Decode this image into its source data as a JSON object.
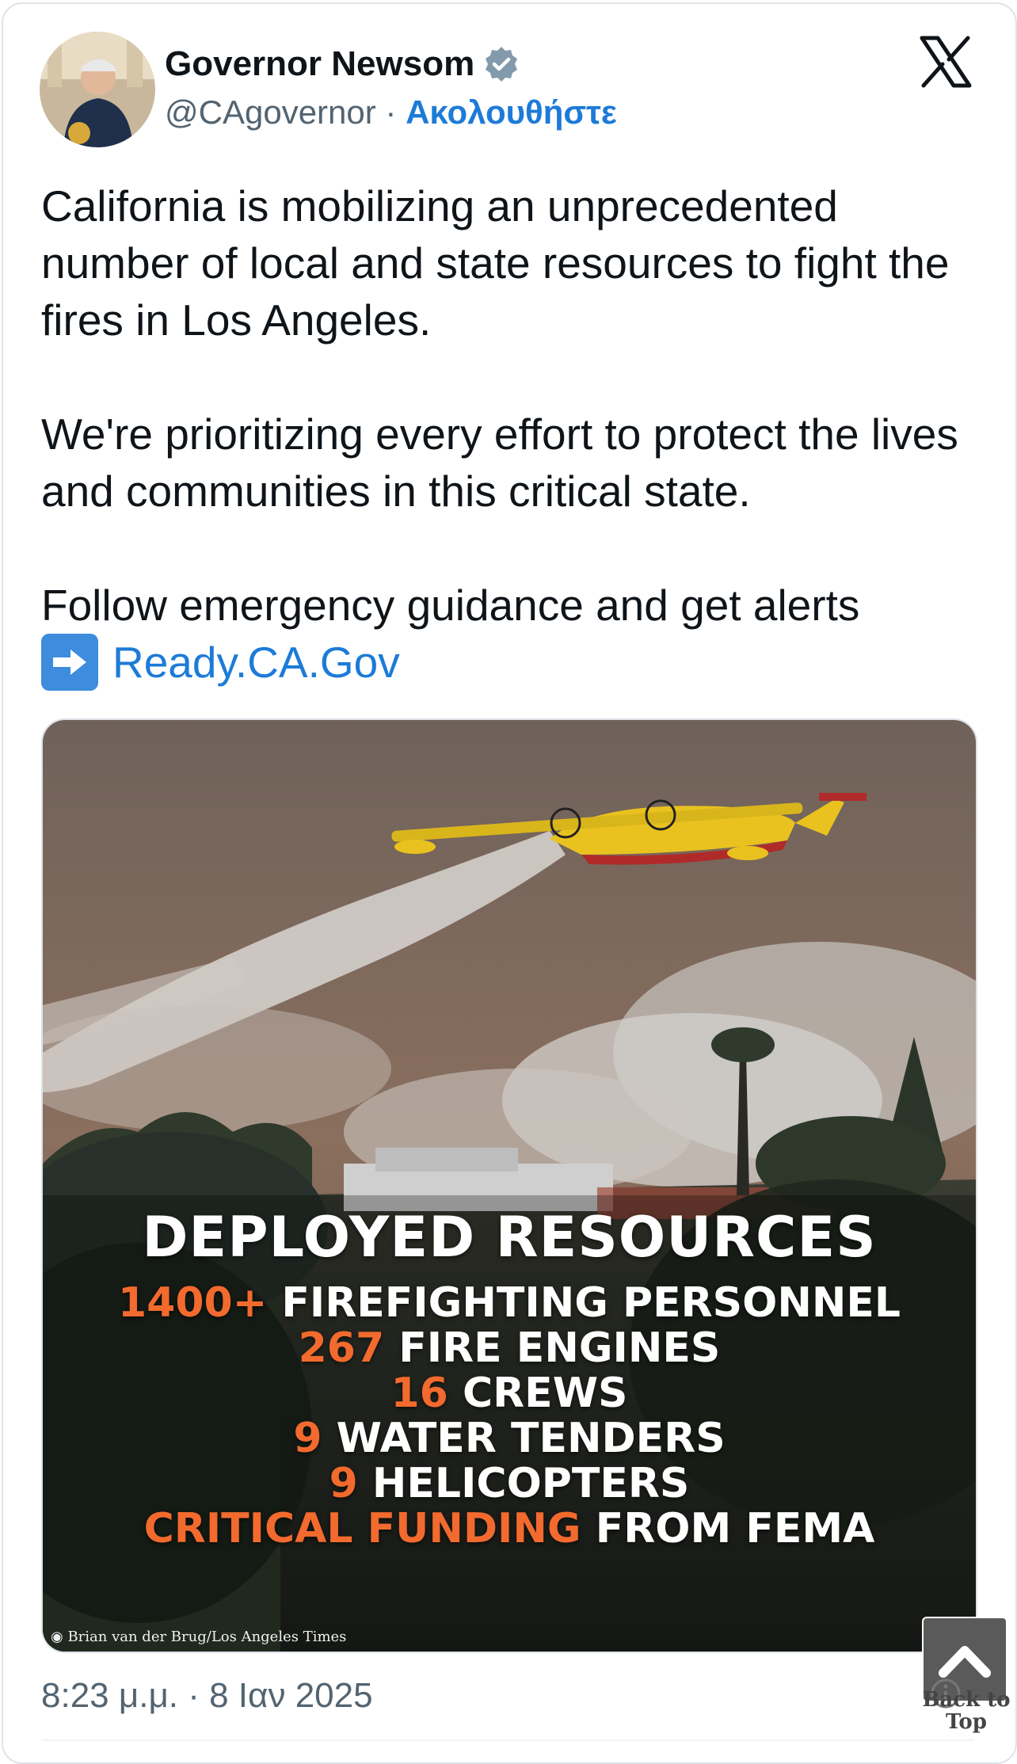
{
  "author": {
    "name": "Governor Newsom",
    "handle": "@CAgovernor",
    "separator": "·",
    "follow_label": "Ακολουθήστε"
  },
  "tweet": {
    "paragraph1": "California is mobilizing an unprecedented number of local and state resources to fight the fires in Los Angeles.",
    "paragraph2": "We're prioritizing every effort to protect the lives and communities in this critical state.",
    "paragraph3": "Follow emergency guidance and get alerts",
    "link_text": "Ready.CA.Gov"
  },
  "media": {
    "title": "DEPLOYED RESOURCES",
    "lines": [
      {
        "number": "1400+",
        "text": "FIREFIGHTING PERSONNEL"
      },
      {
        "number": "267",
        "text": "FIRE ENGINES"
      },
      {
        "number": "16",
        "text": "CREWS"
      },
      {
        "number": "9",
        "text": "WATER TENDERS"
      },
      {
        "number": "9",
        "text": "HELICOPTERS"
      },
      {
        "number": "CRITICAL FUNDING",
        "text": "FROM FEMA"
      }
    ],
    "credit": "Brian van der Brug/Los Angeles Times"
  },
  "timestamp": "8:23 μ.μ. · 8 Ιαν 2025",
  "back_to_top": {
    "label": "Back to Top"
  },
  "colors": {
    "accent": "#1d7bd8",
    "orange": "#f26a2e",
    "text": "#0f1419",
    "muted": "#536471"
  }
}
